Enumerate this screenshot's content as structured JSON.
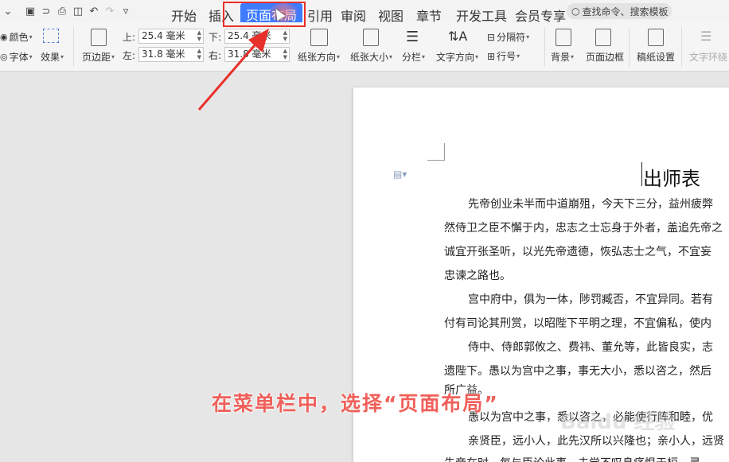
{
  "quick_access": {
    "save_icon": "save-icon",
    "undo_icon": "undo-icon",
    "redo_icon": "redo-icon"
  },
  "tabs": [
    {
      "label": "开始"
    },
    {
      "label": "插入"
    },
    {
      "label": "页面布局",
      "active": true
    },
    {
      "label": "引用"
    },
    {
      "label": "审阅"
    },
    {
      "label": "视图"
    },
    {
      "label": "章节"
    },
    {
      "label": "开发工具"
    },
    {
      "label": "会员专享"
    }
  ],
  "search": {
    "placeholder": "查找命令、搜索模板"
  },
  "ribbon": {
    "color": "颜色",
    "font": "字体",
    "effect": "效果",
    "margin_button": "页边距",
    "top_label": "上:",
    "top_value": "25.4 毫米",
    "bottom_label": "下:",
    "bottom_value": "25.4 毫米",
    "left_label": "左:",
    "left_value": "31.8 毫米",
    "right_label": "右:",
    "right_value": "31.8 毫米",
    "orientation": "纸张方向",
    "size": "纸张大小",
    "columns": "分栏",
    "text_direction": "文字方向",
    "separator": "分隔符",
    "line_number": "行号",
    "background": "背景",
    "page_border": "页面边框",
    "grid_paper": "稿纸设置",
    "text_wrap": "文字环绕"
  },
  "document": {
    "title": "出师表",
    "lines": [
      "先帝创业未半而中道崩殂，今天下三分，益州疲弊",
      "然侍卫之臣不懈于内，忠志之士忘身于外者，盖追先帝之",
      "诚宜开张圣听，以光先帝遗德，恢弘志士之气，不宜妄",
      "忠谏之路也。",
      "宫中府中，俱为一体，陟罚臧否，不宜异同。若有",
      "付有司论其刑赏，以昭陛下平明之理，不宜偏私，使内",
      "侍中、侍郎郭攸之、费祎、董允等，此皆良实，志",
      "遗陛下。愚以为宫中之事，事无大小，悉以咨之，然后",
      "所广益。",
      "愚以为宫中之事，悉以咨之，必能使行阵和睦，优",
      "亲贤臣，远小人，此先汉所以兴隆也；亲小人，远贤",
      "先帝在时，每与臣论此事，未尝不叹息痛恨于桓、灵"
    ]
  },
  "annotation": {
    "caption": "在菜单栏中，选择“页面布局”",
    "watermark": "Baidu 经验",
    "color": "#e8302a"
  }
}
